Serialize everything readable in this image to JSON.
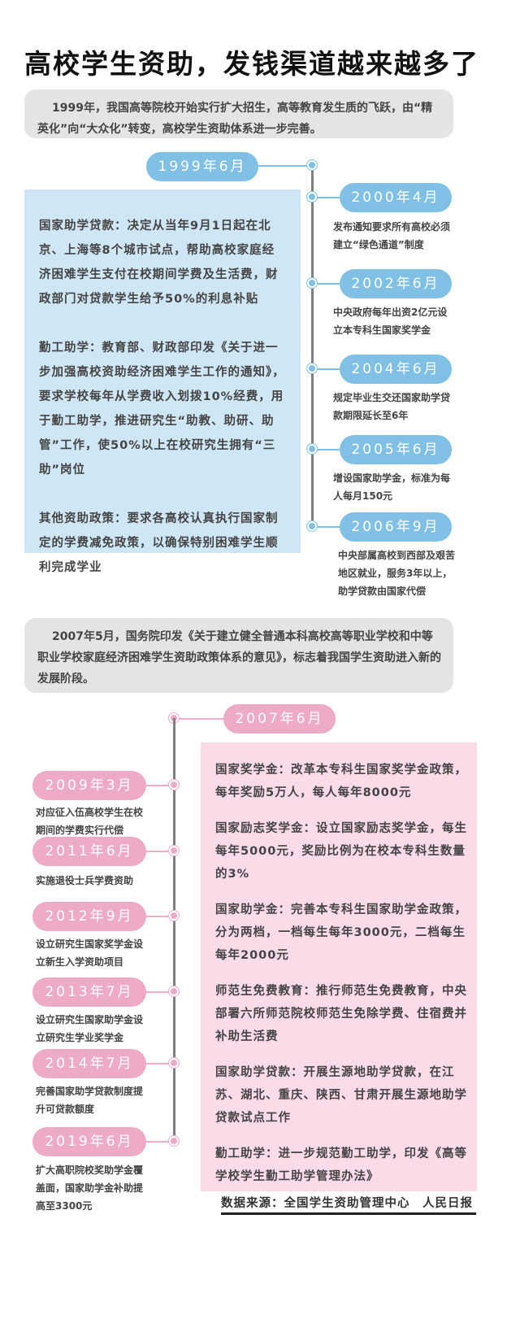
{
  "title": "高校学生资助，发钱渠道越来越多了",
  "intro1": "1999年，我国高等院校开始实行扩大招生，高等教育发生质的飞跃，由“精英化”向“大众化”转变，高校学生资助体系进一步完善。",
  "timeline1": {
    "main_date": "1999年6月",
    "policies": [
      "国家助学贷款：决定从当年9月1日起在北京、上海等8个城市试点，帮助高校家庭经济困难学生支付在校期间学费及生活费，财政部门对贷款学生给予50%的利息补贴",
      "勤工助学：教育部、财政部印发《关于进一步加强高校资助经济困难学生工作的通知》，要求学校每年从学费收入划拨10%经费，用于勤工助学，推进研究生“助教、助研、助管”工作，使50%以上在校研究生拥有“三助”岗位",
      "其他资助政策：要求各高校认真执行国家制定的学费减免政策，以确保特别困难学生顺利完成学业"
    ],
    "events": [
      {
        "date": "2000年4月",
        "text": "发布通知要求所有高校必须建立“绿色通道”制度"
      },
      {
        "date": "2002年6月",
        "text": "中央政府每年出资2亿元设立本专科生国家奖学金"
      },
      {
        "date": "2004年6月",
        "text": "规定毕业生交还国家助学贷款期限延长至6年"
      },
      {
        "date": "2005年6月",
        "text": "增设国家助学金，标准为每人每月150元"
      },
      {
        "date": "2006年9月",
        "text": "中央部属高校到西部及艰苦地区就业，服务3年以上，助学贷款由国家代偿"
      }
    ]
  },
  "intro2": "2007年5月，国务院印发《关于建立健全普通本科高校高等职业学校和中等职业学校家庭经济困难学生资助政策体系的意见》，标志着我国学生资助进入新的发展阶段。",
  "timeline2": {
    "main_date": "2007年6月",
    "policies": [
      "国家奖学金：改革本专科生国家奖学金政策，每年奖励5万人，每人每年8000元",
      "国家励志奖学金：设立国家励志奖学金，每生每年5000元，奖励比例为在校本专科生数量的3%",
      "国家助学金：完善本专科生国家助学金政策，分为两档，一档每生每年3000元，二档每生每年2000元",
      "师范生免费教育：推行师范生免费教育，中央部署六所师范院校师范生免除学费、住宿费并补助生活费",
      "国家助学贷款：开展生源地助学贷款，在江苏、湖北、重庆、陕西、甘肃开展生源地助学贷款试点工作",
      "勤工助学：进一步规范勤工助学，印发《高等学校学生勤工助学管理办法》"
    ],
    "events": [
      {
        "date": "2009年3月",
        "text": "对应征入伍高校学生在校期间的学费实行代偿"
      },
      {
        "date": "2011年6月",
        "text": "实施退役士兵学费资助"
      },
      {
        "date": "2012年9月",
        "text": "设立研究生国家奖学金设立新生入学资助项目"
      },
      {
        "date": "2013年7月",
        "text": "设立研究生国家助学金设立研究生学业奖学金"
      },
      {
        "date": "2014年7月",
        "text": "完善国家助学贷款制度提升可贷款额度"
      },
      {
        "date": "2019年6月",
        "text": "扩大高职院校奖助学金覆盖面，国家助学金补助提高至3300元"
      }
    ]
  },
  "source": "数据来源：全国学生资助管理中心　人民日报",
  "colors": {
    "blue": "#80c0e4",
    "blue_box": "#cfe6f5",
    "pink": "#eeabc7",
    "pink_box": "#fbdbe7",
    "grey_box": "#e4e4e4"
  }
}
